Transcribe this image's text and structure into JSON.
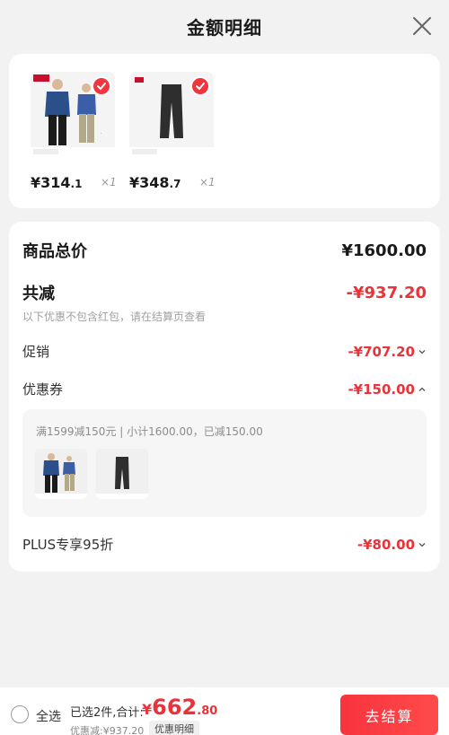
{
  "header": {
    "title": "金额明细"
  },
  "products": [
    {
      "price_int": "¥314",
      "price_dec": ".1",
      "qty": "×1",
      "checked": true
    },
    {
      "price_int": "¥348",
      "price_dec": ".7",
      "qty": "×1",
      "checked": true
    }
  ],
  "summary": {
    "total_label": "商品总价",
    "total_value": "¥1600.00",
    "discount_label": "共减",
    "discount_value": "-¥937.20",
    "hint": "以下优惠不包含红包，请在结算页查看",
    "promo_label": "促销",
    "promo_value": "-¥707.20",
    "coupon_label": "优惠券",
    "coupon_value": "-¥150.00",
    "coupon_desc": "满1599减150元 | 小计1600.00，已减150.00",
    "plus_label": "PLUS专享95折",
    "plus_value": "-¥80.00"
  },
  "bottom": {
    "select_all": "全选",
    "selected_info": "已选2件,合计:",
    "total_symbol": "¥",
    "total_int": "662",
    "total_dec": ".80",
    "discount_info": "优惠减:¥937.20",
    "detail_tag": "优惠明细",
    "checkout": "去结算"
  },
  "colors": {
    "accent": "#e8333b",
    "button": "#f8333d"
  }
}
